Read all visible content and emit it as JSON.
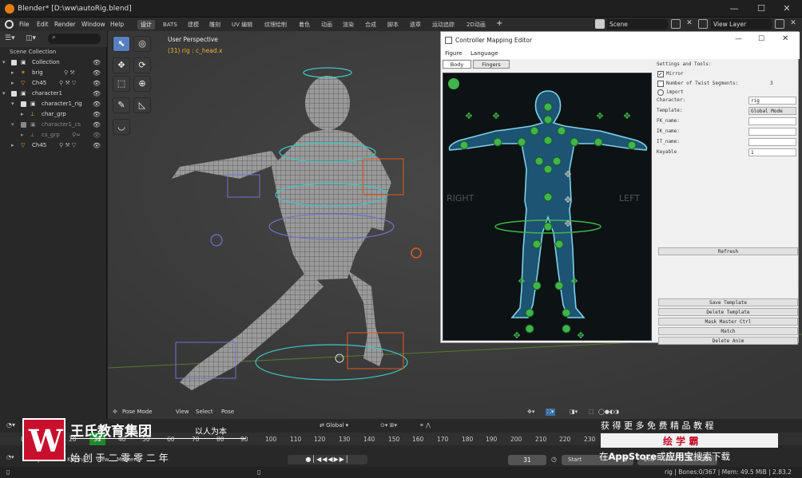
{
  "window": {
    "title": "Blender* [D:\\ww\\autoRig.blend]",
    "minimize": "—",
    "maximize": "☐",
    "close": "✕"
  },
  "menubar": {
    "menus": [
      "File",
      "Edit",
      "Render",
      "Window",
      "Help"
    ],
    "workspaces": [
      "设计",
      "BATS",
      "建模",
      "雕刻",
      "UV 编辑",
      "纹理绘制",
      "着色",
      "动画",
      "渲染",
      "合成",
      "脚本",
      "遗章",
      "运动追踪",
      "2D动画"
    ],
    "active_workspace": "设计",
    "add_workspace": "+",
    "scene_label": "Scene",
    "view_layer_label": "View Layer"
  },
  "outliner": {
    "scene_collection": "Scene Collection",
    "rows": [
      {
        "label": "Collection",
        "indent": 0
      },
      {
        "label": "brig",
        "indent": 1
      },
      {
        "label": "Ch45",
        "indent": 1
      },
      {
        "label": "character1",
        "indent": 0
      },
      {
        "label": "character1_rig",
        "indent": 1
      },
      {
        "label": "char_grp",
        "indent": 2
      },
      {
        "label": "character1_cs",
        "indent": 1
      },
      {
        "label": "cs_grp",
        "indent": 2
      },
      {
        "label": "Ch45",
        "indent": 1
      }
    ]
  },
  "viewport": {
    "perspective": "User Perspective",
    "selection": "(31) rig : c_head.x",
    "mode": "Pose Mode",
    "header_items": [
      "View",
      "Select",
      "Pose"
    ],
    "orientation": "Global"
  },
  "cme": {
    "title": "Controller Mapping Editor",
    "menus": [
      "Figure",
      "Language"
    ],
    "tabs": [
      "Body",
      "Fingers"
    ],
    "active_tab": "Body",
    "right_side": "RIGHT",
    "left_side": "LEFT",
    "settings_title": "Settings and Tools:",
    "mirror": "Mirror",
    "num_segments_label": "Number of Twist Segments:",
    "num_segments_value": "3",
    "import": "import",
    "fields": [
      {
        "label": "Character:",
        "value": "rig"
      },
      {
        "label": "Template:",
        "value": "Global Mode"
      },
      {
        "label": "FK_name:",
        "value": ""
      },
      {
        "label": "IK_name:",
        "value": ""
      },
      {
        "label": "IT_name:",
        "value": ""
      },
      {
        "label": "Keyable",
        "value": "1"
      }
    ],
    "refresh": "Refresh",
    "buttons": [
      "Save Template",
      "Delete Template",
      "Mask Master Ctrl",
      "Match",
      "Delete Anim"
    ]
  },
  "timeline": {
    "menus": [
      "Playback",
      "Keying",
      "View",
      "Marker"
    ],
    "frames": [
      "0",
      "20",
      "30",
      "40",
      "50",
      "60",
      "70",
      "80",
      "90",
      "100",
      "110",
      "120",
      "130",
      "140",
      "150",
      "160",
      "170",
      "180",
      "190",
      "200",
      "210",
      "220",
      "230",
      "240",
      "250"
    ],
    "current_frame": "31",
    "start_label": "Start",
    "start_value": "1",
    "end_label": "End",
    "end_value": "250"
  },
  "status": {
    "text": "rig | Bones:0/367 | Mem: 49.5 MiB | 2.83.2"
  },
  "watermark": {
    "logo_letter": "W",
    "org": "王氏教育集团",
    "motto": "以人为本",
    "year_line": "始 创 于 二 零 零 二 年",
    "promo": "获 得 更 多 免 费 精 品 教 程",
    "brand": "绘 学 霸",
    "store_line_a": "在",
    "store_app": "AppStore",
    "store_line_b": "或",
    "store_app2": "应用宝",
    "store_line_c": "搜索下载"
  },
  "colors": {
    "accent": "#5680c2",
    "active_frame": "#1e8a2f",
    "controller_green": "#3fb54a",
    "body_outline": "#7dd1e8",
    "watermark_red": "#c8102e"
  }
}
